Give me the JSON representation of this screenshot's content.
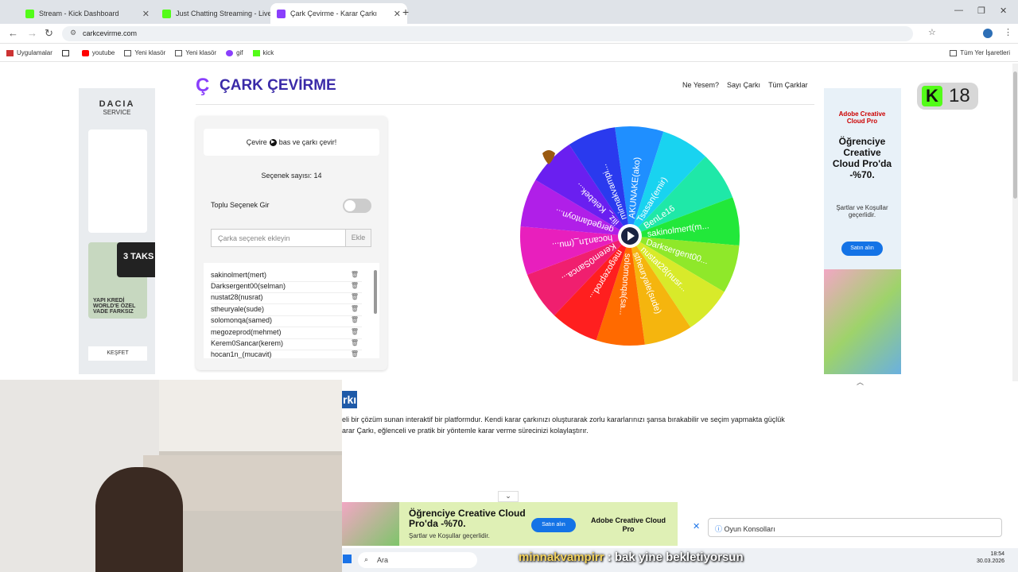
{
  "browser": {
    "tabs": [
      {
        "title": "Stream - Kick Dashboard",
        "active": false
      },
      {
        "title": "Just Chatting Streaming - Live S",
        "active": false
      },
      {
        "title": "Çark Çevirme - Karar Çarkı",
        "active": true
      }
    ],
    "new_tab": "+",
    "url": "carkcevirme.com",
    "bookmarks": [
      "Uygulamalar",
      "youtube",
      "Yeni klasör",
      "Yeni klasör",
      "gif",
      "kick"
    ],
    "bookmarks_right": "Tüm Yer İşaretleri"
  },
  "site": {
    "logo_mark": "Ç",
    "logo_text": "ÇARK ÇEVİRME",
    "nav": [
      "Ne Yesem?",
      "Sayı Çarkı",
      "Tüm Çarklar"
    ]
  },
  "panel": {
    "spin_hint_before": "Çevire",
    "spin_hint_after": "bas ve çarkı çevir!",
    "option_count": "Seçenek sayısı: 14",
    "bulk_label": "Toplu Seçenek Gir",
    "bulk_enabled": false,
    "add_placeholder": "Çarka seçenek ekleyin",
    "add_button": "Ekle",
    "options": [
      "sakinolmert(mert)",
      "Darksergent00(selman)",
      "nustat28(nusrat)",
      "stheuryale(sude)",
      "solomonqa(samed)",
      "megozeprod(mehmet)",
      "Kerem0Sancar(kerem)",
      "hocan1n_(mucavit)"
    ]
  },
  "wheel": {
    "segments": [
      {
        "label": "AKUNAKE(ako)",
        "color": "#1f8fff"
      },
      {
        "label": "Tsasan(emir)",
        "color": "#19d3f0"
      },
      {
        "label": "BenLe16",
        "color": "#1fe8a8"
      },
      {
        "label": "sakinolmert(m...",
        "color": "#22e83a"
      },
      {
        "label": "Darksergent00...",
        "color": "#8fe82a"
      },
      {
        "label": "nustat28(nusr...",
        "color": "#d8ea2a"
      },
      {
        "label": "stheuryale(sude)",
        "color": "#f5b50e"
      },
      {
        "label": "solomonqa(sa...",
        "color": "#ff6a00"
      },
      {
        "label": "megozeprod...",
        "color": "#ff1f1f"
      },
      {
        "label": "Kerem0Sanca...",
        "color": "#f01f6f"
      },
      {
        "label": "hocan1n_(mu...",
        "color": "#e81fbd"
      },
      {
        "label": "gergedantoyn...",
        "color": "#b01fe8"
      },
      {
        "label": "iliz_ Kelebek...",
        "color": "#6a1ff0"
      },
      {
        "label": "minnakvampi...",
        "color": "#2a3aee"
      }
    ]
  },
  "ads": {
    "left_brand": "DACIA",
    "left_sub": "SERVICE",
    "left_promo": "3 TAKS",
    "left_bank": "YAPI KREDİ WORLD'E ÖZEL VADE FARKSIZ",
    "left_cta": "KEŞFET",
    "right_brand": "Adobe Creative Cloud Pro",
    "right_headline": "Öğrenciye Creative Cloud Pro'da -%70.",
    "right_terms": "Şartlar ve Koşullar geçerlidir.",
    "right_cta": "Satın alın",
    "bottom_headline": "Öğrenciye Creative Cloud Pro'da -%70.",
    "bottom_terms": "Şartlar ve Koşullar geçerlidir.",
    "bottom_cta": "Satın alın",
    "bottom_brand": "Adobe Creative Cloud Pro",
    "oyun_konsollari": "Oyun Konsolları"
  },
  "article": {
    "heading_fragment": "rkı",
    "line1": "eli bir çözüm sunan interaktif bir platformdur. Kendi karar çarkınızı oluşturarak zorlu kararlarınızı şansa bırakabilir ve seçim yapmakta güçlük",
    "line2": "arar Çarkı, eğlenceli ve pratik bir yöntemle karar verme sürecinizi kolaylaştırır."
  },
  "overlay": {
    "kick_badge": "18",
    "chat_user": "minnakvampirr",
    "chat_message": ": bak yine bekletiyorsun"
  },
  "taskbar": {
    "search": "Ara",
    "time": "18:54",
    "date": "30.03.2026"
  }
}
